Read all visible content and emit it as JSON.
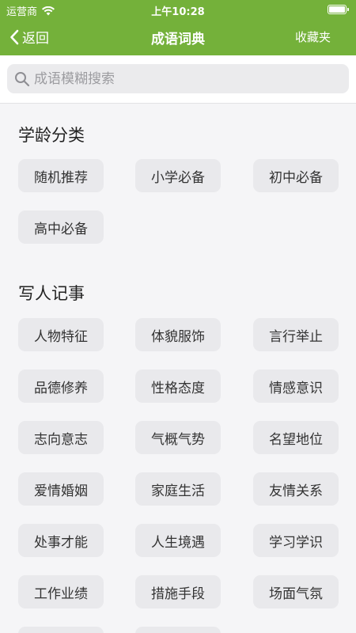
{
  "status_bar": {
    "carrier": "运营商",
    "time": "上午10:28"
  },
  "nav": {
    "back_label": "返回",
    "title": "成语词典",
    "favorites_label": "收藏夹"
  },
  "search": {
    "placeholder": "成语模糊搜索",
    "value": ""
  },
  "sections": [
    {
      "title": "学龄分类",
      "items": [
        "随机推荐",
        "小学必备",
        "初中必备",
        "高中必备"
      ]
    },
    {
      "title": "写人记事",
      "items": [
        "人物特征",
        "体貌服饰",
        "言行举止",
        "品德修养",
        "性格态度",
        "情感意识",
        "志向意志",
        "气概气势",
        "名望地位",
        "爱情婚姻",
        "家庭生活",
        "友情关系",
        "处事才能",
        "人生境遇",
        "学习学识",
        "工作业绩",
        "措施手段",
        "场面气氛"
      ]
    }
  ],
  "colors": {
    "header_bg": "#74b13a",
    "tag_bg": "#e9e9ec",
    "page_bg": "#f5f5f7"
  },
  "icons": {
    "back": "chevron-left-icon",
    "search": "search-icon",
    "wifi": "wifi-icon",
    "battery": "battery-icon"
  }
}
